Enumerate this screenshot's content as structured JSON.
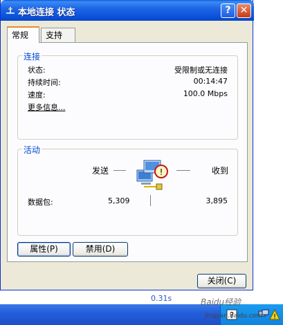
{
  "window": {
    "title": "本地连接 状态",
    "help_label": "?",
    "close_label": "✕",
    "tabs": [
      {
        "label": "常规",
        "active": true
      },
      {
        "label": "支持",
        "active": false
      }
    ]
  },
  "connection": {
    "group_title": "连接",
    "rows": [
      {
        "label": "状态:",
        "value": "受限制或无连接"
      },
      {
        "label": "持续时间:",
        "value": "00:14:47"
      },
      {
        "label": "速度:",
        "value": "100.0 Mbps"
      }
    ],
    "more_info": "更多信息..."
  },
  "activity": {
    "group_title": "活动",
    "sent_label": "发送",
    "received_label": "收到",
    "packets_label": "数据包:",
    "packets_sent": "5,309",
    "packets_received": "3,895"
  },
  "buttons": {
    "properties": "属性(P)",
    "disable": "禁用(D)",
    "close": "关闭(C)"
  },
  "taskbar": {
    "speed": "0.31s",
    "watermark": "Baidu经验",
    "watermark_sub": "jingyan.baidu.com"
  },
  "colors": {
    "titlebar": "#0a4fd9",
    "group_title": "#0046d5",
    "dialog_bg": "#ece9d8"
  }
}
